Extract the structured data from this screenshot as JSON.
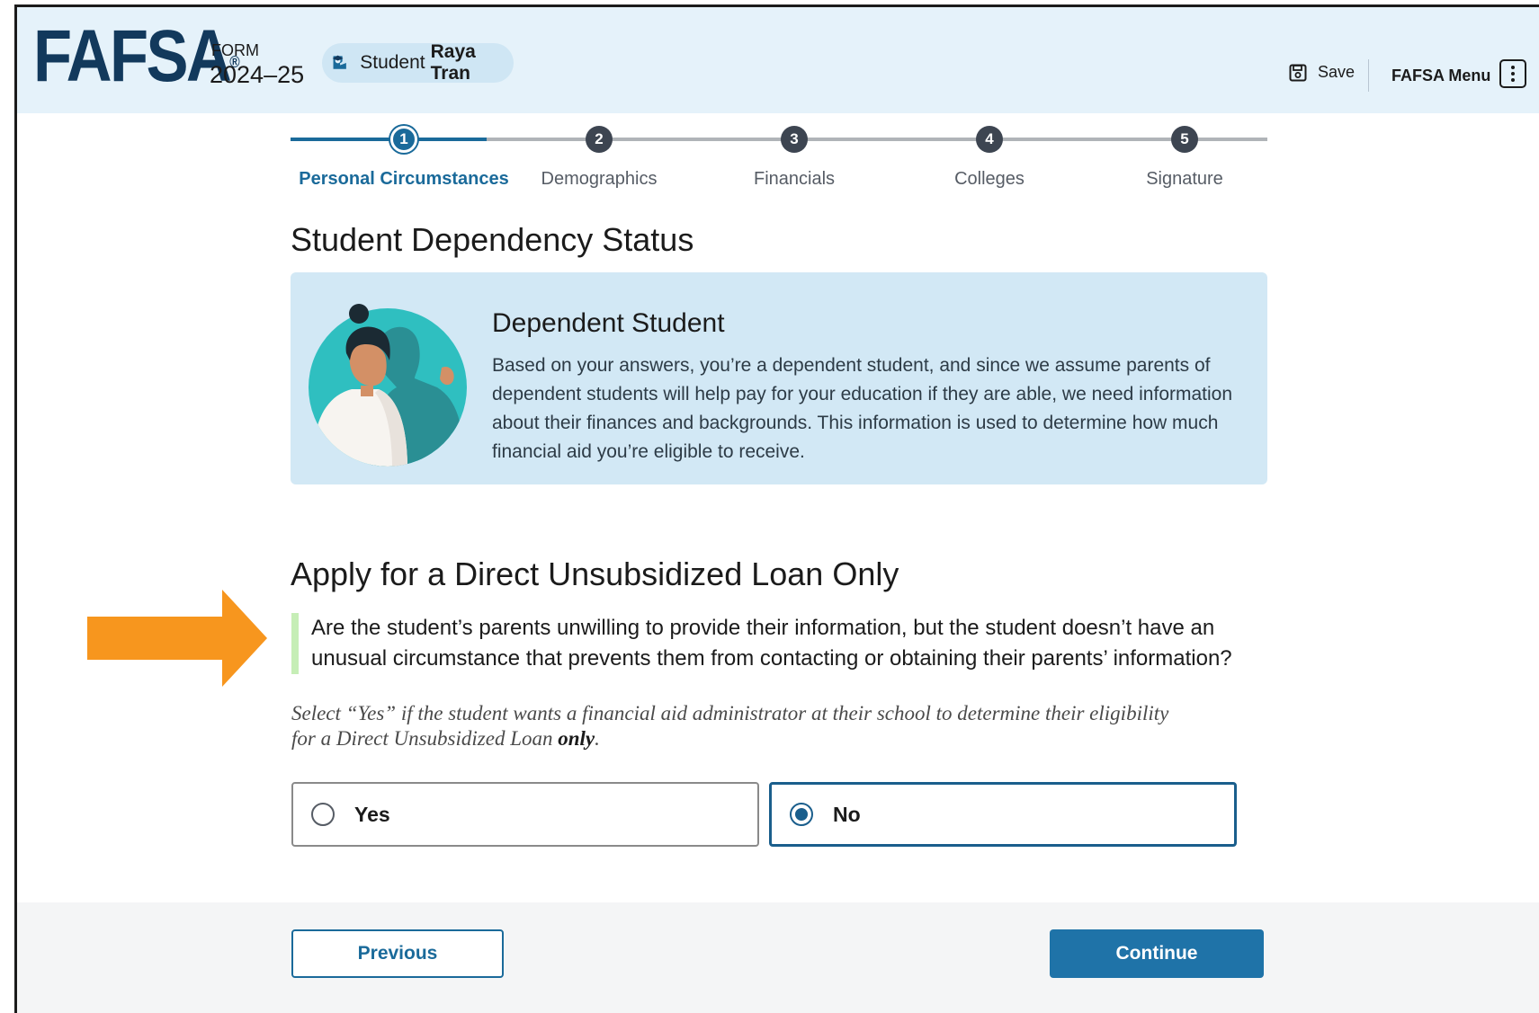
{
  "header": {
    "logo_text": "FAFSA",
    "logo_reg": "®",
    "form_label": "FORM",
    "form_year": "2024–25",
    "student_prefix": "Student",
    "student_name": "Raya Tran",
    "save_label": "Save",
    "menu_label": "FAFSA Menu"
  },
  "stepper": {
    "steps": [
      {
        "number": "1",
        "label": "Personal Circumstances",
        "state": "active"
      },
      {
        "number": "2",
        "label": "Demographics",
        "state": "upcoming"
      },
      {
        "number": "3",
        "label": "Financials",
        "state": "upcoming"
      },
      {
        "number": "4",
        "label": "Colleges",
        "state": "upcoming"
      },
      {
        "number": "5",
        "label": "Signature",
        "state": "upcoming"
      }
    ],
    "active_color": "#1a6a9a",
    "inactive_color": "#3d4551"
  },
  "main": {
    "page_title": "Student Dependency Status",
    "card": {
      "title": "Dependent Student",
      "text": "Based on your answers, you’re a dependent student, and since we assume parents of dependent students will help pay for your education if they are able, we need information about their finances and backgrounds. This information is used to determine how much financial aid you’re eligible to receive."
    },
    "section_title": "Apply for a Direct Unsubsidized Loan Only",
    "question": "Are the student’s parents unwilling to provide their information, but the student doesn’t have an unusual circumstance that prevents them from contacting or obtaining their parents’ information?",
    "hint_main": "Select “Yes” if the student wants a financial aid administrator at their school to determine their eligibility for a Direct Unsubsidized Loan ",
    "hint_emph": "only",
    "hint_end": ".",
    "options": [
      {
        "label": "Yes",
        "selected": false
      },
      {
        "label": "No",
        "selected": true
      }
    ]
  },
  "footer": {
    "previous_label": "Previous",
    "continue_label": "Continue"
  },
  "colors": {
    "header_bg": "#e5f2fa",
    "brand_navy": "#12395c",
    "primary": "#1f73a8",
    "annotation_arrow": "#f7961e",
    "question_bar": "#c6eeb6"
  }
}
